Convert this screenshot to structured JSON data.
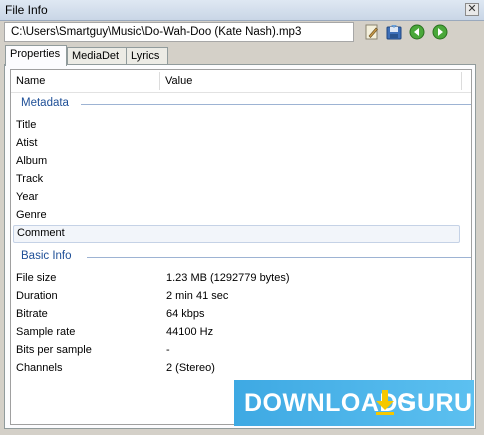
{
  "window": {
    "title": "File Info",
    "close_glyph": "✕"
  },
  "toolbar": {
    "path": "C:\\Users\\Smartguy\\Music\\Do-Wah-Doo (Kate Nash).mp3",
    "icons": [
      "edit-icon",
      "save-icon",
      "back-icon",
      "forward-icon"
    ]
  },
  "tabs": [
    {
      "label": "Properties",
      "active": true
    },
    {
      "label": "MediaDet",
      "active": false
    },
    {
      "label": "Lyrics",
      "active": false
    }
  ],
  "list": {
    "columns": [
      "Name",
      "Value"
    ],
    "groups": [
      {
        "title": "Metadata",
        "rows": [
          {
            "name": "Title",
            "value": ""
          },
          {
            "name": "Atist",
            "value": ""
          },
          {
            "name": "Album",
            "value": ""
          },
          {
            "name": "Track",
            "value": ""
          },
          {
            "name": "Year",
            "value": ""
          },
          {
            "name": "Genre",
            "value": ""
          },
          {
            "name": "Comment",
            "value": ""
          }
        ]
      },
      {
        "title": "Basic Info",
        "rows": [
          {
            "name": "File size",
            "value": "1.23 MB (1292779 bytes)"
          },
          {
            "name": "Duration",
            "value": "2 min 41 sec"
          },
          {
            "name": "Bitrate",
            "value": "64 kbps"
          },
          {
            "name": "Sample rate",
            "value": "44100 Hz"
          },
          {
            "name": "Bits per sample",
            "value": "-"
          },
          {
            "name": "Channels",
            "value": "2 (Stereo)"
          }
        ]
      }
    ]
  },
  "watermark": {
    "text_left": "DOWNLOADS",
    "text_right": "GURU",
    "accent": "#f5c800"
  },
  "colors": {
    "group_title": "#1e4f97",
    "selection": "#f2f5fa"
  }
}
